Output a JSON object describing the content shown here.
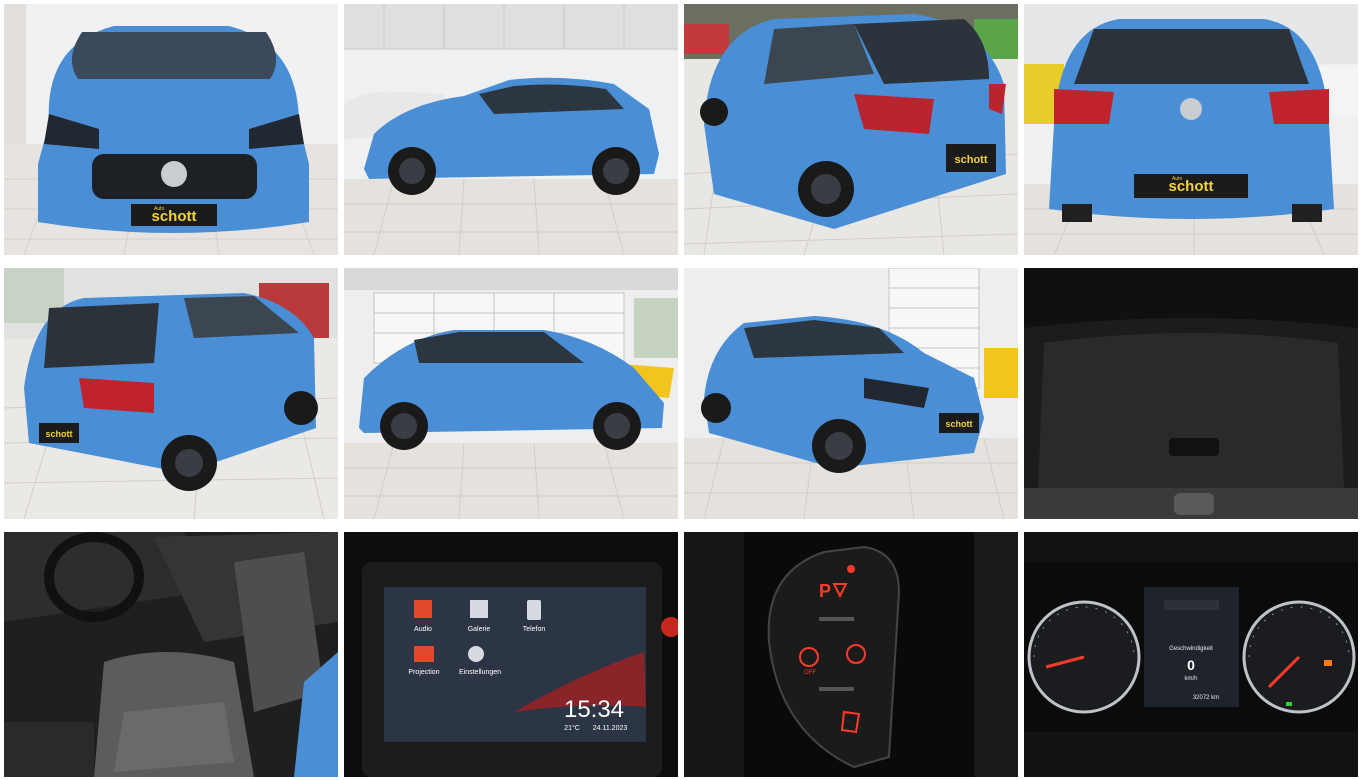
{
  "gallery": {
    "items": [
      {
        "view": "front",
        "plate_text": "schott",
        "plate_sub": "Auto"
      },
      {
        "view": "side-left"
      },
      {
        "view": "rear-three-quarter-left",
        "plate_text": "schott"
      },
      {
        "view": "rear",
        "plate_text": "schott",
        "plate_sub": "Auto"
      },
      {
        "view": "rear-three-quarter-left-2",
        "plate_text": "schott"
      },
      {
        "view": "side-left-2"
      },
      {
        "view": "front-three-quarter-right",
        "plate_text": "schott"
      },
      {
        "view": "trunk"
      },
      {
        "view": "interior-driver-seat"
      },
      {
        "view": "infotainment",
        "screen": {
          "apps": [
            "Audio",
            "Galerie",
            "Telefon",
            "Projection",
            "Einstellungen"
          ],
          "time": "15:34",
          "temp": "21°C",
          "date": "24.11.2023"
        }
      },
      {
        "view": "console-buttons",
        "button_labels": [
          "P",
          "OFF"
        ]
      },
      {
        "view": "instrument-cluster",
        "cluster": {
          "title": "Geschwindigkeit",
          "speed": "0",
          "unit": "km/h",
          "odometer": "32072 km"
        }
      }
    ]
  },
  "colors": {
    "car_blue": "#4a8fd6",
    "floor": "#e9e7e4",
    "wall": "#f2f2f2",
    "glow_red": "#ff3a2a"
  }
}
